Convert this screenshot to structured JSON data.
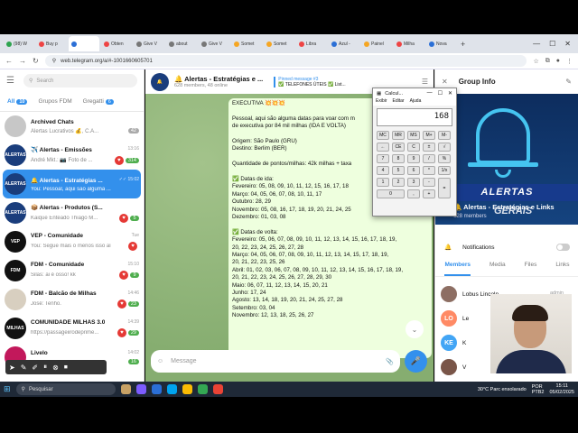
{
  "browser": {
    "tabs": [
      {
        "label": "(98) W",
        "color": "#2ea44f"
      },
      {
        "label": "Buy p",
        "color": "#e44"
      },
      {
        "label": "",
        "color": "#2b6fd6",
        "active": true
      },
      {
        "label": "Obten",
        "color": "#e44"
      },
      {
        "label": "Give V",
        "color": "#777"
      },
      {
        "label": "about",
        "color": "#777"
      },
      {
        "label": "Give V",
        "color": "#777"
      },
      {
        "label": "Somet",
        "color": "#f5a623"
      },
      {
        "label": "Somet",
        "color": "#f5a623"
      },
      {
        "label": "Libra",
        "color": "#e44"
      },
      {
        "label": "Azul -",
        "color": "#2b6fd6"
      },
      {
        "label": "Painel",
        "color": "#f5a623"
      },
      {
        "label": "Milha",
        "color": "#e44"
      },
      {
        "label": "Nova",
        "color": "#2b6fd6"
      }
    ],
    "new_tab": "+",
    "url": "web.telegram.org/a/#-1001660605701"
  },
  "sidebar": {
    "search_placeholder": "Search",
    "folders": [
      {
        "label": "All",
        "badge": "10",
        "active": true
      },
      {
        "label": "Grupos FDM",
        "badge": ""
      },
      {
        "label": "Gregatti",
        "badge": "6"
      }
    ],
    "chats": [
      {
        "name": "Archived Chats",
        "preview": "Alertas Lucrativos 💰, C.A...",
        "time": "",
        "count": "42",
        "avatar_color": "#c7c7c7",
        "avatar_text": "",
        "muted": true
      },
      {
        "name": "✈️ Alertas - Emissões",
        "preview": "André Mkt.: 📷 Foto de ...",
        "time": "13:16",
        "count": "314",
        "heart": true,
        "avatar_color": "#1a3d7c",
        "avatar_text": "ALERTAS"
      },
      {
        "name": "🔔 Alertas - Estratégias ...",
        "preview": "You: Pessoal, aqui são alguma ...",
        "time": "✓✓ 15:02",
        "count": "",
        "selected": true,
        "avatar_color": "#1a3d7c",
        "avatar_text": "ALERTAS"
      },
      {
        "name": "📦 Alertas - Produtos (S...",
        "preview": "Kaique Enteado Thiago M...",
        "time": "",
        "count": "5",
        "heart": true,
        "avatar_color": "#1a3d7c",
        "avatar_text": "ALERTAS"
      },
      {
        "name": "VEP - Comunidade",
        "preview": "You: Segue mais o menos isso aí",
        "time": "Tue",
        "count": "",
        "heart": true,
        "avatar_color": "#111",
        "avatar_text": "VEP"
      },
      {
        "name": "FDM - Comunidade",
        "preview": "Silas: ai é osso! kk",
        "time": "15:10",
        "count": "9",
        "heart": true,
        "avatar_color": "#111",
        "avatar_text": "FDM"
      },
      {
        "name": "FDM - Balcão de Milhas",
        "preview": "José: Tenho.",
        "time": "14:46",
        "count": "23",
        "heart": true,
        "avatar_color": "#d8cfc0",
        "avatar_text": ""
      },
      {
        "name": "COMUNIDADE MILHAS 3.0",
        "preview": "https://passageiirodeprime...",
        "time": "14:39",
        "count": "29",
        "heart": true,
        "avatar_color": "#111",
        "avatar_text": "MILHAS"
      },
      {
        "name": "Livelo",
        "preview": "",
        "time": "14:02",
        "count": "16",
        "avatar_color": "#c2185b",
        "avatar_text": ""
      }
    ]
  },
  "chat": {
    "title": "🔔 Alertas - Estratégias e ...",
    "subtitle": "628 members, 48 online",
    "pinned_label": "Pinned message #3",
    "pinned_text": "✅ TELEFONES ÚTEIS ✅ List...",
    "message_lines": [
      "EXECUTIVA 💥💥💥",
      "",
      "Pessoal, aqui são alguma datas para voar com m",
      "de executiva por 84 mil milhas (IDA E VOLTA)",
      "",
      "Origem: São Paulo (GRU)",
      "Destino: Berlim (BER)",
      "",
      "Quantidade de pontos/milhas: 42k milhas + taxa",
      "",
      "✅ Datas de ida:",
      "Fevereiro: 05, 08, 09, 10, 11, 12, 15, 16, 17, 18",
      "Março: 04, 05, 06, 07, 08, 10, 11, 17",
      "Outubro: 28, 29",
      "Novembro: 05, 08, 16, 17, 18, 19, 20, 21, 24, 25",
      "Dezembro: 01, 03, 08",
      "",
      "✅ Datas de volta:",
      "Fevereiro: 05, 06, 07, 08, 09, 10, 11, 12, 13, 14, 15, 16, 17, 18, 19,",
      "20, 22, 23, 24, 25, 26, 27, 28",
      "Março: 04, 05, 06, 07, 08, 09, 10, 11, 12, 13, 14, 15, 17, 18, 19,",
      "20, 21, 22, 23, 25, 26",
      "Abril: 01, 02, 03, 06, 07, 08, 09, 10, 11, 12, 13, 14, 15, 16, 17, 18, 19,",
      "20, 21, 22, 23, 24, 25, 26, 27, 28, 29, 30",
      "Maio: 06, 07, 11, 12, 13, 14, 15, 20, 21",
      "Junho: 17, 24",
      "Agosto: 13, 14, 18, 19, 20, 21, 24, 25, 27, 28",
      "Setembro: 03, 04",
      "Novembro: 12, 13, 18, 25, 26, 27"
    ],
    "composer_placeholder": "Message"
  },
  "group_info": {
    "title": "Group Info",
    "banner_text": "ALERTAS",
    "banner_sub": "GERAIS",
    "name": "🔔 Alertas - Estratégias e Links",
    "members_count": "628 members",
    "notifications_label": "Notifications",
    "tabs": [
      "Members",
      "Media",
      "Files",
      "Links"
    ],
    "members": [
      {
        "name": "Lobus Lincoln",
        "role": "admin",
        "initials": "",
        "color": "#8d6e63"
      },
      {
        "name": "Le",
        "role": "",
        "initials": "LO",
        "color": "#ff8a65"
      },
      {
        "name": "K",
        "role": "",
        "initials": "KE",
        "color": "#42a5f5"
      },
      {
        "name": "V",
        "role": "",
        "initials": "",
        "color": "#795548"
      }
    ]
  },
  "calculator": {
    "title": "Calcul...",
    "menu": [
      "Exibir",
      "Editar",
      "Ajuda"
    ],
    "display": "168",
    "keys": [
      "MC",
      "MR",
      "MS",
      "M+",
      "M-",
      "←",
      "CE",
      "C",
      "±",
      "√",
      "7",
      "8",
      "9",
      "/",
      "%",
      "4",
      "5",
      "6",
      "*",
      "1/x",
      "1",
      "2",
      "3",
      "-",
      "=",
      "0",
      ",",
      "+"
    ]
  },
  "taskbar": {
    "search_label": "Pesquisar",
    "weather": "30°C  Parc ensolarado",
    "lang": "POR\nPTB2",
    "time": "15:11",
    "date": "05/02/2025"
  }
}
